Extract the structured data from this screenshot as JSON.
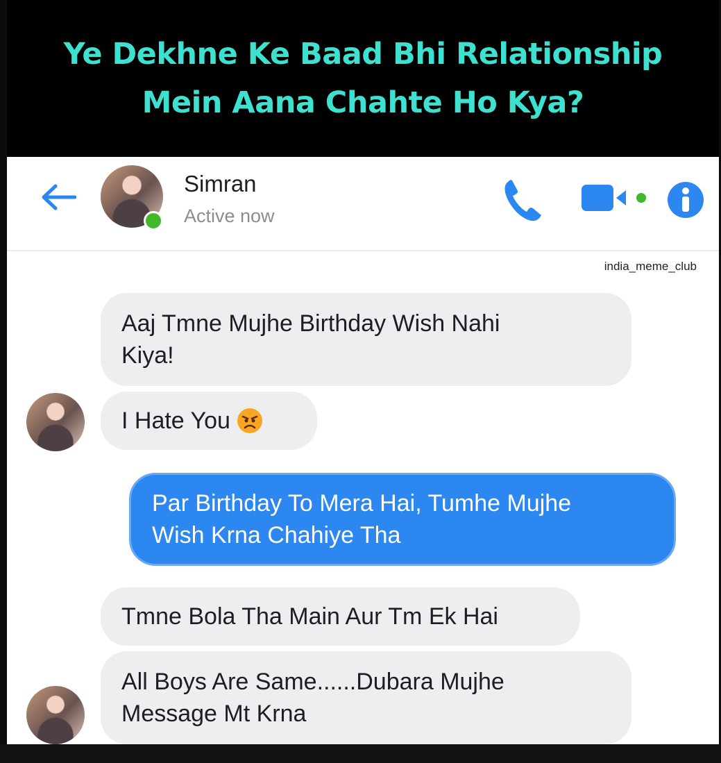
{
  "meme": {
    "title_line1": "Ye Dekhne Ke Baad Bhi Relationship",
    "title_line2": "Mein Aana Chahte Ho Kya?",
    "title_color": "#3ee0d0",
    "watermark": "india_meme_club"
  },
  "header": {
    "contact_name": "Simran",
    "status": "Active now",
    "back_icon": "arrow-left-icon",
    "call_icon": "phone-icon",
    "video_icon": "video-camera-icon",
    "info_icon": "info-icon",
    "accent_color": "#2d87f0",
    "online_color": "#42b72a"
  },
  "messages": [
    {
      "direction": "incoming",
      "lines": [
        "Aaj Tmne Mujhe Birthday Wish Nahi",
        "Kiya!"
      ]
    },
    {
      "direction": "incoming",
      "text": "I Hate You",
      "emoji": "angry-face-icon"
    },
    {
      "direction": "outgoing",
      "lines": [
        "Par Birthday To Mera Hai, Tumhe Mujhe",
        "Wish Krna Chahiye Tha"
      ]
    },
    {
      "direction": "incoming",
      "text": "Tmne Bola Tha Main Aur Tm Ek Hai"
    },
    {
      "direction": "incoming",
      "lines": [
        "All Boys Are Same......Dubara Mujhe",
        "Message Mt Krna"
      ]
    }
  ]
}
